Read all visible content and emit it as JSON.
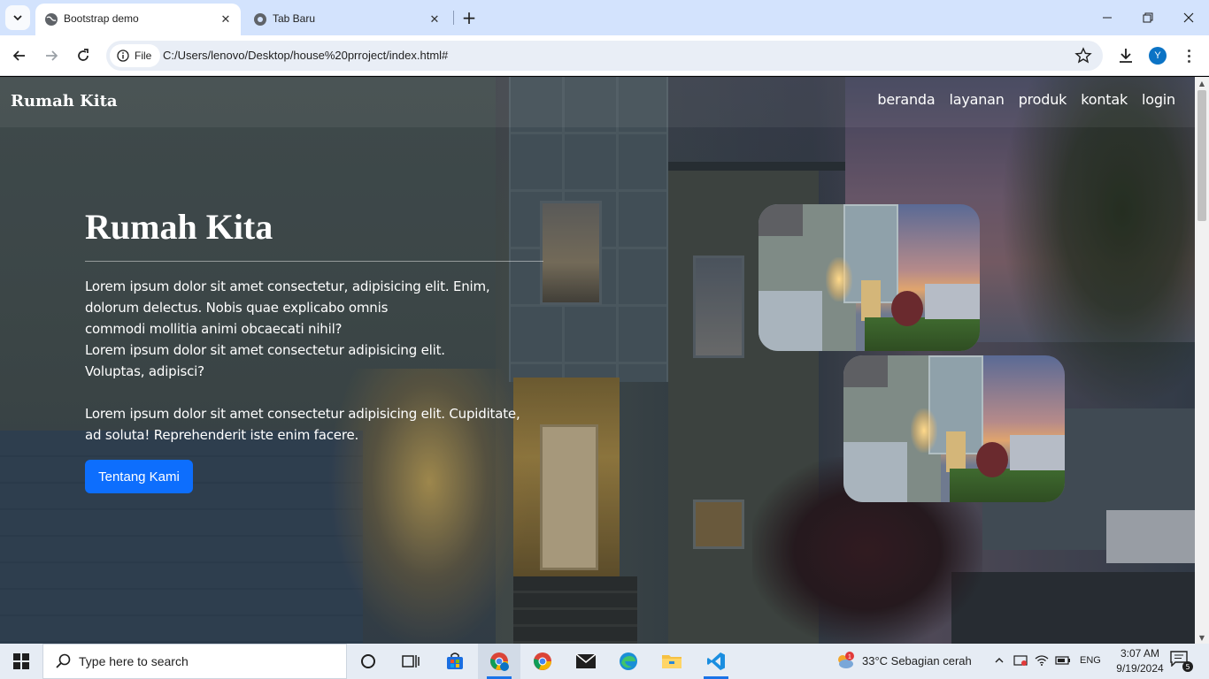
{
  "browser": {
    "tabs": [
      {
        "title": "Bootstrap demo",
        "active": true
      },
      {
        "title": "Tab Baru",
        "active": false
      }
    ],
    "site_info_label": "File",
    "url": "C:/Users/lenovo/Desktop/house%20prroject/index.html#",
    "profile_initial": "Y"
  },
  "page": {
    "brand": "Rumah Kita",
    "nav": [
      "beranda",
      "layanan",
      "produk",
      "kontak",
      "login"
    ],
    "hero": {
      "title": "Rumah Kita",
      "paragraph1_lines": [
        "Lorem ipsum dolor sit amet consectetur, adipisicing elit. Enim,",
        "dolorum delectus. Nobis quae explicabo omnis",
        "commodi mollitia animi obcaecati nihil?",
        "Lorem ipsum dolor sit amet consectetur adipisicing elit.",
        "Voluptas, adipisci?"
      ],
      "paragraph2_lines": [
        "Lorem ipsum dolor sit amet consectetur adipisicing elit. Cupiditate,",
        "ad soluta! Reprehenderit iste enim facere."
      ],
      "cta_label": "Tentang Kami"
    },
    "colors": {
      "primary": "#0d6efd",
      "text": "#ffffff"
    }
  },
  "taskbar": {
    "search_placeholder": "Type here to search",
    "apps": [
      "task-view",
      "widgets",
      "microsoft-store",
      "chrome-profile",
      "chrome",
      "mail",
      "edge",
      "file-explorer",
      "vscode"
    ],
    "weather_badge": "1",
    "weather": "33°C  Sebagian cerah",
    "language": "ENG",
    "time": "3:07 AM",
    "date": "9/19/2024",
    "notification_count": "5"
  }
}
